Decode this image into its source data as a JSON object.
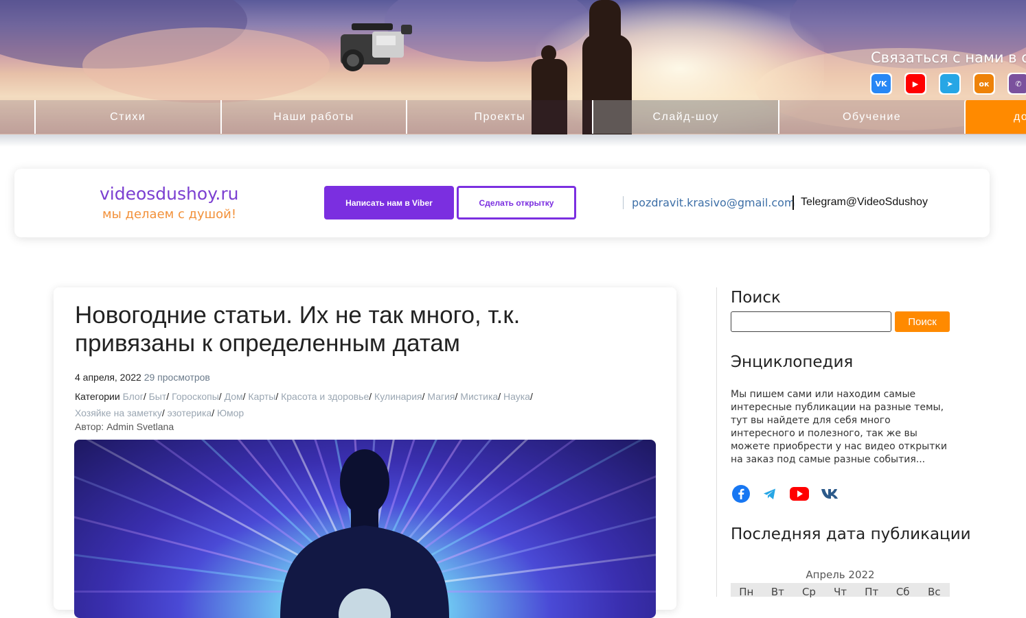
{
  "header": {
    "contact_title": "Связаться с нами в с",
    "social": [
      {
        "name": "vk-icon",
        "color": "#2787f5",
        "glyph": "VK"
      },
      {
        "name": "youtube-icon",
        "color": "#ff0000",
        "glyph": "▶"
      },
      {
        "name": "telegram-icon",
        "color": "#27a6e5",
        "glyph": "➤"
      },
      {
        "name": "odnoklassniki-icon",
        "color": "#ee8208",
        "glyph": "ок"
      },
      {
        "name": "viber-icon",
        "color": "#7b519d",
        "glyph": "✆"
      }
    ]
  },
  "nav": {
    "items": [
      "Стихи",
      "Наши работы",
      "Проекты",
      "Слайд-шоу",
      "Обучение"
    ],
    "highlight": "до"
  },
  "topbar": {
    "site_name": "videosdushoy.ru",
    "slogan": "мы делаем с душой!",
    "viber_button": "Написать нам в Viber",
    "card_button": "Сделать открытку",
    "email": "pozdravit.krasivo@gmail.com",
    "telegram": "Telegram@VideoSdushoy"
  },
  "article": {
    "title": "Новогодние статьи. Их не так много, т.к. привязаны к определенным датам",
    "date": "4 апреля, 2022",
    "views": "29 просмотров",
    "categories_label": "Категории",
    "categories": [
      "Блог",
      "Быт",
      "Гороскопы",
      "Дом",
      "Карты",
      "Красота и здоровье",
      "Кулинария",
      "Магия",
      "Мистика",
      "Наука",
      "Хозяйке на заметку",
      "эзотерика",
      "Юмор"
    ],
    "author": "Автор: Admin Svetlana"
  },
  "sidebar": {
    "search_title": "Поиск",
    "search_value": "",
    "search_button": "Поиск",
    "encyclopedia_title": "Энциклопедия",
    "encyclopedia_text": "Мы пишем сами или находим самые интересные публикации на разные темы, тут вы найдете для себя много интересного и полезного, так же вы можете приобрести у нас видео открытки на заказ под самые разные события...",
    "last_pub_title": "Последняя дата публикации",
    "calendar_caption": "Апрель 2022",
    "weekdays": [
      "Пн",
      "Вт",
      "Ср",
      "Чт",
      "Пт",
      "Сб",
      "Вс"
    ]
  },
  "colors": {
    "accent_purple": "#7b2fe0",
    "accent_orange": "#ff8a00",
    "link_blue": "#3d6fa7"
  }
}
